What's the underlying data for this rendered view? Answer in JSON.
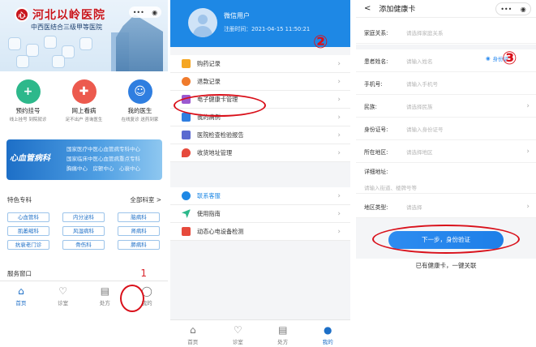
{
  "panel1": {
    "hospital_name": "河北以岭医院",
    "logo_mark": "心",
    "subtitle": "中西医结合三级甲等医院",
    "capsule": {
      "more": "•••",
      "close": "◉"
    },
    "quick": [
      {
        "title": "预约挂号",
        "desc": "线上挂号 到院就诊",
        "icon": "calendar-icon",
        "color": "#2db88b",
        "glyph": "+"
      },
      {
        "title": "网上看病",
        "desc": "足不出户 咨询医生",
        "icon": "chat-icon",
        "color": "#ec5a4e",
        "glyph": "✚"
      },
      {
        "title": "我的医生",
        "desc": "在线复诊 送药到家",
        "icon": "doctor-icon",
        "color": "#2f7ee0",
        "glyph": "☺"
      }
    ],
    "banner": {
      "left": "心血管病科",
      "lines": [
        "国家医疗中医心血管病专科中心",
        "国家临床中医心血管病重点专科",
        "胸痛中心　房颤中心　心衰中心"
      ]
    },
    "dept_title": "特色专科",
    "dept_all": "全部科室 >",
    "departments": [
      "心血管科",
      "内分泌科",
      "脑病科",
      "肌萎缩科",
      "风湿病科",
      "肾病科",
      "抗衰老门诊",
      "骨伤科",
      "肺病科"
    ],
    "service_label": "服务窗口",
    "annotation": "1",
    "tabs": [
      {
        "label": "首页",
        "icon": "home-icon",
        "glyph": "⌂",
        "active": true
      },
      {
        "label": "诊室",
        "icon": "stethoscope-icon",
        "glyph": "♡",
        "active": false
      },
      {
        "label": "处方",
        "icon": "prescription-icon",
        "glyph": "▤",
        "active": false
      },
      {
        "label": "我的",
        "icon": "user-icon",
        "glyph": "◯",
        "active": false
      }
    ]
  },
  "panel2": {
    "user_name": "微信用户",
    "register_time": "注册时间：2021-04-15 11:50:21",
    "annotation": "②",
    "group1": [
      {
        "label": "购药记录",
        "icon": "cart-icon",
        "color": "#f5a623"
      },
      {
        "label": "退款记录",
        "icon": "refund-icon",
        "color": "#f07b2c"
      },
      {
        "label": "电子健康卡管理",
        "icon": "card-icon",
        "color": "#9b59d0"
      },
      {
        "label": "我的病例",
        "icon": "record-icon",
        "color": "#2f7ee0"
      },
      {
        "label": "医院检查检验报告",
        "icon": "report-icon",
        "color": "#5b6ad0"
      },
      {
        "label": "收货地址管理",
        "icon": "location-icon",
        "color": "#e64a3c"
      }
    ],
    "group2": [
      {
        "label": "联系客服",
        "icon": "headset-icon",
        "color": "#1e88e5",
        "highlight": true
      },
      {
        "label": "使用指南",
        "icon": "guide-icon",
        "color": "#2db88b"
      },
      {
        "label": "动态心电设备检测",
        "icon": "ecg-icon",
        "color": "#e64a3c"
      }
    ],
    "tabs": [
      {
        "label": "首页",
        "icon": "home-icon",
        "glyph": "⌂",
        "active": false
      },
      {
        "label": "诊室",
        "icon": "stethoscope-icon",
        "glyph": "♡",
        "active": false
      },
      {
        "label": "处方",
        "icon": "prescription-icon",
        "glyph": "▤",
        "active": false
      },
      {
        "label": "我的",
        "icon": "user-icon",
        "glyph": "●",
        "active": true
      }
    ]
  },
  "panel3": {
    "back": "<",
    "title": "添加健康卡",
    "capsule": {
      "more": "•••",
      "close": "◉"
    },
    "annotation": "③",
    "ocr_label": "身份证",
    "fields": [
      {
        "key": "家庭关系:",
        "value": "请选择家庭关系",
        "arrow": false
      },
      {
        "key": "患者姓名:",
        "value": "请输入姓名",
        "arrow": false
      },
      {
        "key": "手机号:",
        "value": "请输入手机号",
        "arrow": false
      },
      {
        "key": "民族:",
        "value": "请选择民族",
        "arrow": true
      },
      {
        "key": "身份证号:",
        "value": "请输入身份证号",
        "arrow": false
      },
      {
        "key": "所在地区:",
        "value": "请选择地区",
        "arrow": true
      }
    ],
    "address_label": "详细地址:",
    "address_placeholder": "请输入街道、楼牌号等",
    "region_type_label": "地区类型:",
    "region_type_value": "请选择",
    "submit": "下一步，身份验证",
    "link": "已有健康卡，一键关联"
  }
}
